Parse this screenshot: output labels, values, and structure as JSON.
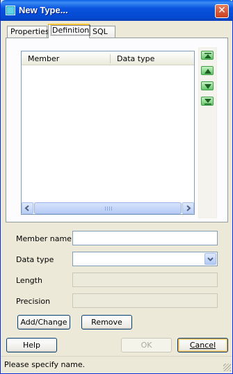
{
  "window": {
    "title": "New Type..."
  },
  "tabs": [
    {
      "label": "Properties",
      "active": false
    },
    {
      "label": "Definition",
      "active": true
    },
    {
      "label": "SQL",
      "active": false
    }
  ],
  "members_table": {
    "columns": [
      "Member",
      "Data type"
    ],
    "rows": []
  },
  "form": {
    "member_name_label": "Member name",
    "member_name_value": "",
    "data_type_label": "Data type",
    "data_type_value": "",
    "length_label": "Length",
    "length_value": "",
    "precision_label": "Precision",
    "precision_value": ""
  },
  "actions": {
    "add_change_label": "Add/Change",
    "remove_label": "Remove"
  },
  "footer": {
    "help_label": "Help",
    "ok_label": "OK",
    "cancel_label": "Cancel"
  },
  "status": {
    "text": "Please specify name."
  },
  "colors": {
    "title_bar": "#0a53dd",
    "order_buttons": "#63c96b",
    "default_button_focus": "#f5b957"
  },
  "icons": [
    "close-icon",
    "move-top-icon",
    "move-up-icon",
    "move-down-icon",
    "move-bottom-icon",
    "scroll-left-icon",
    "scroll-right-icon",
    "dropdown-arrow-icon"
  ]
}
